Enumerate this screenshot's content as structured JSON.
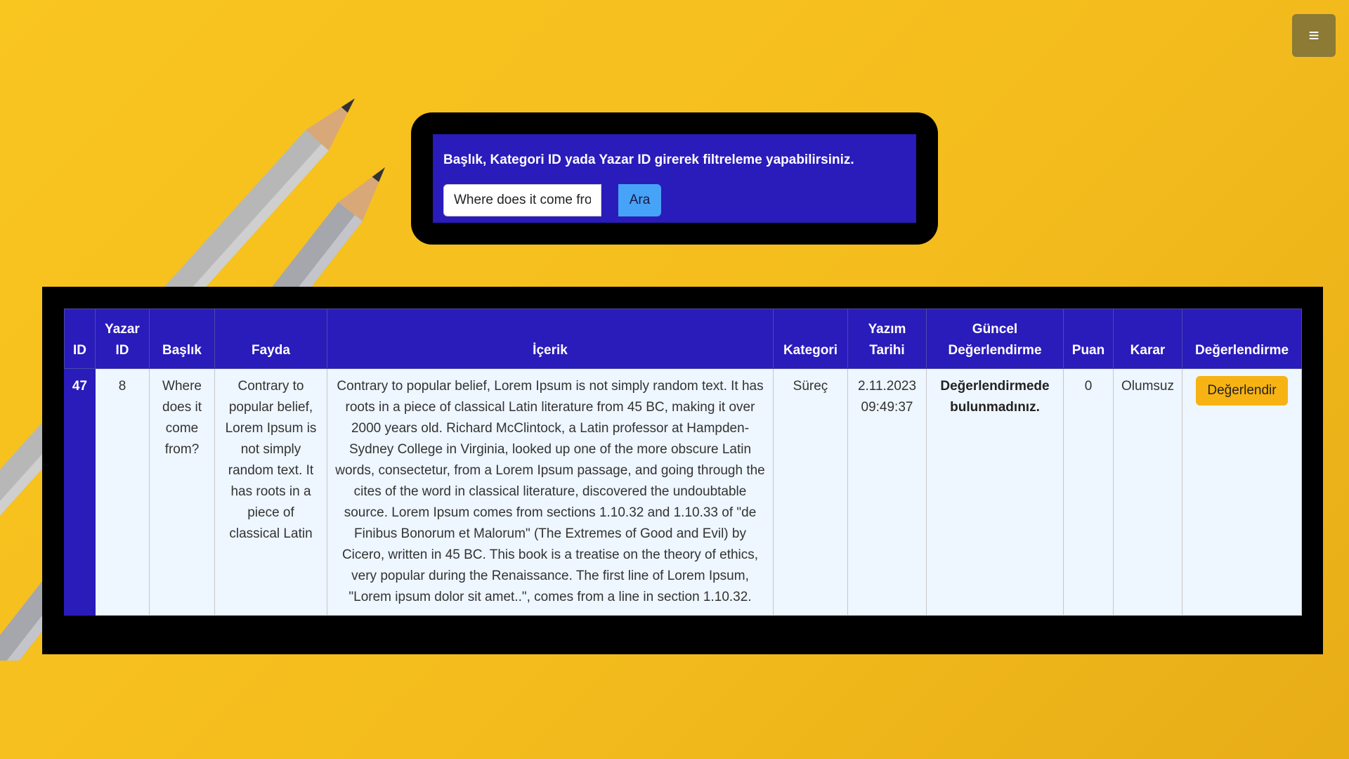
{
  "menu": {
    "icon": "hamburger-icon",
    "glyph": "≡"
  },
  "search": {
    "title": "Başlık, Kategori ID yada Yazar ID girerek filtreleme yapabilirsiniz.",
    "value": "Where does it come from?",
    "button_label": "Ara"
  },
  "table": {
    "headers": [
      "ID",
      "Yazar ID",
      "Başlık",
      "Fayda",
      "İçerik",
      "Kategori",
      "Yazım Tarihi",
      "Güncel Değerlendirme",
      "Puan",
      "Karar",
      "Değerlendirme"
    ],
    "rows": [
      {
        "id": "47",
        "author_id": "8",
        "title": "Where does it come from?",
        "benefit": "Contrary to popular belief, Lorem Ipsum is not simply random text. It has roots in a piece of classical Latin",
        "content": "Contrary to popular belief, Lorem Ipsum is not simply random text. It has roots in a piece of classical Latin literature from 45 BC, making it over 2000 years old. Richard McClintock, a Latin professor at Hampden-Sydney College in Virginia, looked up one of the more obscure Latin words, consectetur, from a Lorem Ipsum passage, and going through the cites of the word in classical literature, discovered the undoubtable source. Lorem Ipsum comes from sections 1.10.32 and 1.10.33 of \"de Finibus Bonorum et Malorum\" (The Extremes of Good and Evil) by Cicero, written in 45 BC. This book is a treatise on the theory of ethics, very popular during the Renaissance. The first line of Lorem Ipsum, \"Lorem ipsum dolor sit amet..\", comes from a line in section 1.10.32.",
        "category": "Süreç",
        "date": "2.11.2023 09:49:37",
        "current_review": "Değerlendirmede bulunmadınız.",
        "score": "0",
        "decision": "Olumsuz",
        "action_label": "Değerlendir"
      }
    ]
  },
  "colors": {
    "background": "#f9c51f",
    "panel": "#2a1bbb",
    "button_blue": "#46a3f7",
    "button_yellow": "#f7b314"
  }
}
